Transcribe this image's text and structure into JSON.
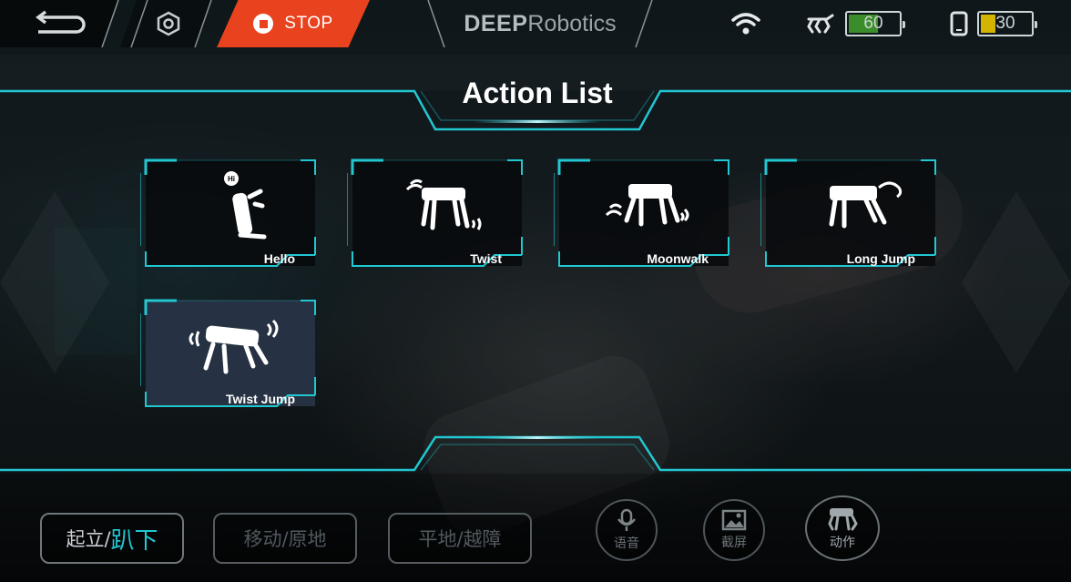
{
  "topbar": {
    "stop_label": "STOP",
    "brand_bold": "DEEP",
    "brand_light": "Robotics",
    "dog_battery": 60,
    "phone_battery": 30,
    "colors": {
      "stop": "#e8421e",
      "accent": "#21c7d1",
      "battery_ok": "#3b8c2a",
      "battery_low": "#d4b400"
    }
  },
  "panel": {
    "title": "Action List",
    "actions": [
      {
        "label": "Hello",
        "icon": "robot-kneel-hello-icon"
      },
      {
        "label": "Twist",
        "icon": "robot-twist-icon"
      },
      {
        "label": "Moonwalk",
        "icon": "robot-moonwalk-icon"
      },
      {
        "label": "Long Jump",
        "icon": "robot-long-jump-icon"
      },
      {
        "label": "Twist Jump",
        "icon": "robot-twist-jump-icon"
      }
    ]
  },
  "bottom": {
    "stand_a": "起立/",
    "stand_b": "趴下",
    "move": "移动/原地",
    "terrain": "平地/越障",
    "voice": "语音",
    "screenshot": "截屏",
    "action": "动作"
  }
}
